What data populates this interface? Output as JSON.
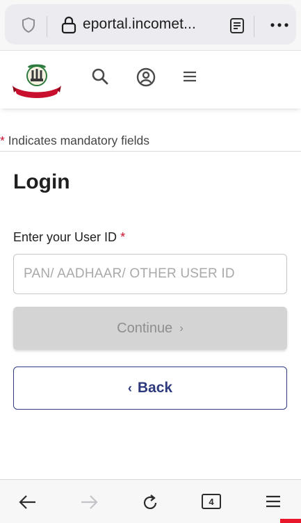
{
  "browser": {
    "url_display": "eportal.incomet...",
    "tab_count": "4"
  },
  "note": {
    "star": "*",
    "mandatory_text": "Indicates mandatory fields"
  },
  "form": {
    "title": "Login",
    "user_id_label": "Enter your User ID",
    "required_star": "*",
    "user_id_value": "",
    "user_id_placeholder": "PAN/ AADHAAR/ OTHER USER ID",
    "continue_label": "Continue",
    "back_label": "Back"
  },
  "colors": {
    "required": "#c8102e",
    "primary": "#2e3a7e",
    "disabled_bg": "#d4d4d4"
  },
  "icons": [
    "shield-icon",
    "lock-icon",
    "reader-icon",
    "more-icon",
    "logo",
    "search-icon",
    "profile-icon",
    "menu-icon",
    "back-arrow-icon",
    "forward-arrow-icon",
    "reload-icon",
    "tabs-icon",
    "hamburger-icon"
  ]
}
